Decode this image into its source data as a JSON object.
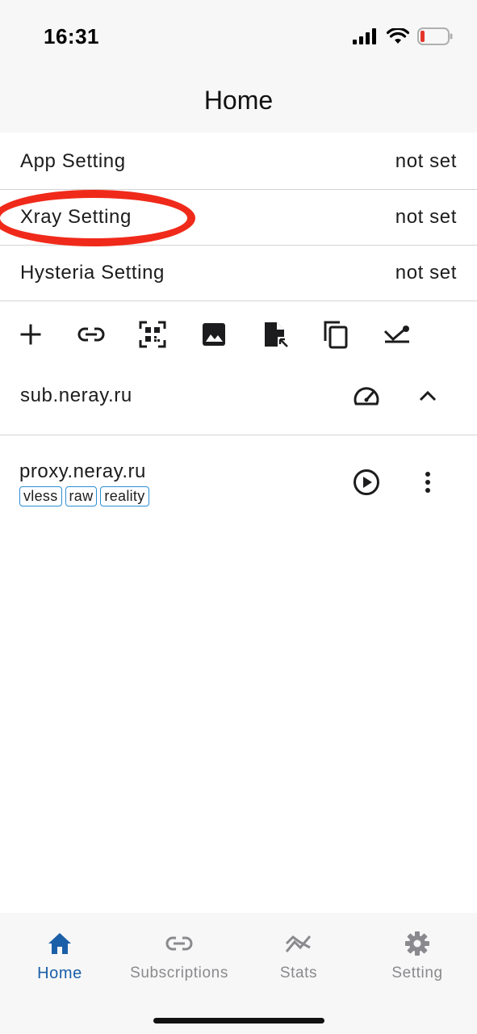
{
  "status_bar": {
    "time": "16:31"
  },
  "nav": {
    "title": "Home"
  },
  "settings": [
    {
      "label": "App Setting",
      "value": "not set"
    },
    {
      "label": "Xray Setting",
      "value": "not set"
    },
    {
      "label": "Hysteria Setting",
      "value": "not set"
    }
  ],
  "toolbar": {
    "icons": [
      "add-icon",
      "link-icon",
      "qr-code-icon",
      "image-icon",
      "file-import-icon",
      "copy-icon",
      "collapse-icon"
    ]
  },
  "subscription": {
    "name": "sub.neray.ru",
    "icons": [
      "speedometer-icon",
      "chevron-up-icon"
    ]
  },
  "server": {
    "name": "proxy.neray.ru",
    "tags": [
      "vless",
      "raw",
      "reality"
    ],
    "icons": [
      "play-icon",
      "more-vert-icon"
    ]
  },
  "tabs": [
    {
      "label": "Home",
      "icon": "home-icon",
      "active": true
    },
    {
      "label": "Subscriptions",
      "icon": "link-icon",
      "active": false
    },
    {
      "label": "Stats",
      "icon": "stats-icon",
      "active": false
    },
    {
      "label": "Setting",
      "icon": "gear-icon",
      "active": false
    }
  ],
  "colors": {
    "accent": "#1b5fa8",
    "tag_border": "#2a8fd6",
    "highlight": "#f02a1a",
    "inactive": "#8a8a8e"
  }
}
